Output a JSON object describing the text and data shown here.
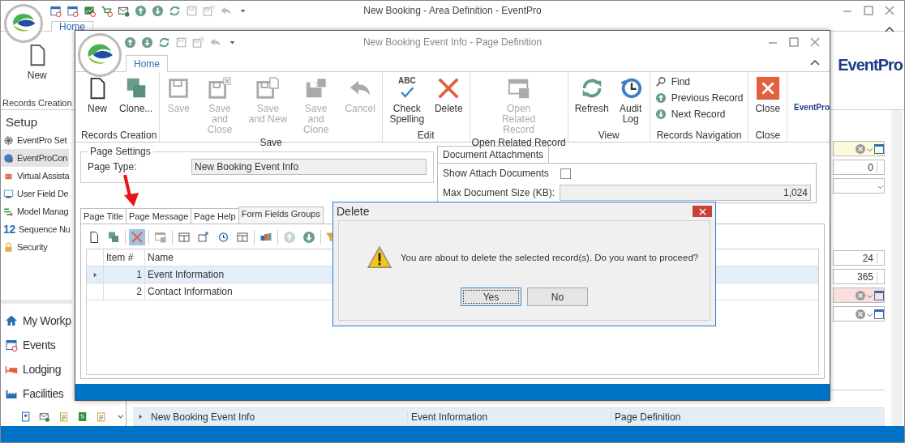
{
  "main_window": {
    "title": "New Booking - Area Definition - EventPro",
    "tabs": [
      {
        "label": "Home",
        "selected": true
      }
    ],
    "ribbon": {
      "button": "New",
      "group": "Records Creation"
    },
    "logo": "EventPro",
    "sidebar": {
      "header": "Setup",
      "items": [
        {
          "label": "EventPro Set",
          "selected": false
        },
        {
          "label": "EventProCon",
          "selected": true
        },
        {
          "label": "Virtual Assista",
          "selected": false
        },
        {
          "label": "User Field De",
          "selected": false
        },
        {
          "label": "Model Manag",
          "selected": false
        },
        {
          "label": "Sequence Nu",
          "selected": false,
          "icon_text": "12"
        },
        {
          "label": "Security",
          "selected": false
        }
      ],
      "nav": [
        "My Workp",
        "Events",
        "Lodging",
        "Facilities"
      ]
    },
    "fields_top": [
      {
        "kind": "lookup",
        "color": "#fdf9dc"
      },
      {
        "kind": "spin",
        "value": "0"
      },
      {
        "kind": "combo"
      }
    ],
    "fields_bottom": [
      {
        "kind": "spin",
        "value": "24"
      },
      {
        "kind": "spin",
        "value": "365"
      },
      {
        "kind": "lookup",
        "color": "#fbdede"
      },
      {
        "kind": "lookup",
        "color": "#ffffff"
      }
    ],
    "grid": {
      "rows": [
        {
          "cells": [
            "New Booking Event Info",
            "Event Information",
            "Page Definition"
          ],
          "selected": true
        }
      ]
    }
  },
  "child_window": {
    "title": "New Booking Event Info - Page Definition",
    "tabs": [
      {
        "label": "Home",
        "selected": true
      }
    ],
    "ribbon": {
      "groups": [
        {
          "label": "Records Creation",
          "buttons": [
            {
              "kind": "large",
              "label": "New",
              "disabled": false
            },
            {
              "kind": "large",
              "label": "Clone...",
              "disabled": false
            }
          ]
        },
        {
          "label": "Save",
          "buttons": [
            {
              "kind": "large",
              "label": "Save",
              "disabled": true
            },
            {
              "kind": "large",
              "label": "Save and Close",
              "disabled": true
            },
            {
              "kind": "large",
              "label": "Save and New",
              "disabled": true
            },
            {
              "kind": "large",
              "label": "Save and Clone",
              "disabled": true
            },
            {
              "kind": "large",
              "label": "Cancel",
              "disabled": true
            }
          ]
        },
        {
          "label": "Edit",
          "buttons": [
            {
              "kind": "large",
              "label": "Check Spelling",
              "disabled": false,
              "icon_text": "ABC"
            },
            {
              "kind": "large",
              "label": "Delete",
              "disabled": false
            }
          ]
        },
        {
          "label": "Open Related Record",
          "buttons": [
            {
              "kind": "large",
              "label": "Open Related Record",
              "disabled": true
            }
          ]
        },
        {
          "label": "View",
          "buttons": [
            {
              "kind": "large",
              "label": "Refresh",
              "disabled": false
            },
            {
              "kind": "large",
              "label": "Audit Log",
              "disabled": false
            }
          ]
        },
        {
          "label": "Records Navigation",
          "buttons": [
            {
              "kind": "small",
              "label": "Find",
              "disabled": false
            },
            {
              "kind": "small",
              "label": "Previous Record",
              "disabled": false
            },
            {
              "kind": "small",
              "label": "Next Record",
              "disabled": false
            }
          ]
        },
        {
          "label": "Close",
          "buttons": [
            {
              "kind": "large",
              "label": "Close",
              "disabled": false
            }
          ]
        }
      ]
    },
    "logo": "EventPro",
    "page_settings": {
      "title": "Page Settings",
      "page_type_label": "Page Type:",
      "page_type": "New Booking Event Info"
    },
    "document_attachments": {
      "title": "Document Attachments",
      "show_label": "Show Attach Documents",
      "show_checked": false,
      "max_label": "Max Document Size (KB):",
      "max_value": "1,024"
    },
    "page_tabs": [
      {
        "label": "Page Title",
        "selected": false
      },
      {
        "label": "Page Message",
        "selected": false
      },
      {
        "label": "Page Help",
        "selected": false
      },
      {
        "label": "Form Fields Groups",
        "selected": true
      }
    ],
    "grid_toolbar": [
      {
        "selected": false,
        "disabled": false
      },
      {
        "selected": false,
        "disabled": false
      },
      {
        "selected": true,
        "disabled": false
      },
      {
        "selected": false,
        "disabled": true
      },
      {
        "selected": false,
        "disabled": false
      },
      {
        "selected": false,
        "disabled": false
      },
      {
        "selected": false,
        "disabled": false
      },
      {
        "selected": false,
        "disabled": false
      },
      {
        "selected": false,
        "disabled": false
      },
      {
        "selected": false,
        "disabled": true
      },
      {
        "selected": false,
        "disabled": false
      }
    ],
    "grid": {
      "columns": [
        "Item #",
        "Name"
      ],
      "rows": [
        {
          "cells": [
            "1",
            "Event Information"
          ],
          "selected": true
        },
        {
          "cells": [
            "2",
            "Contact Information"
          ],
          "selected": false
        }
      ]
    }
  },
  "dialog": {
    "title": "Delete",
    "message": "You are about to delete the selected record(s). Do you want to proceed?",
    "buttons": [
      {
        "label": "Yes",
        "selected": true
      },
      {
        "label": "No",
        "selected": false
      }
    ]
  }
}
